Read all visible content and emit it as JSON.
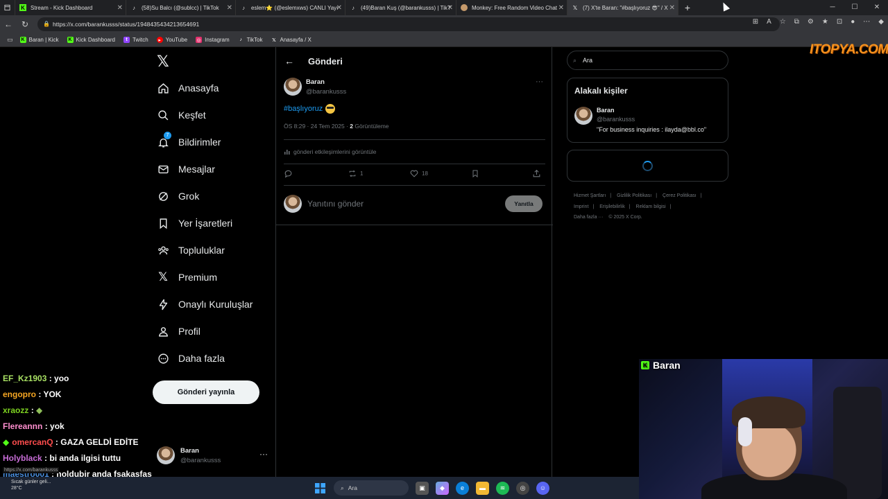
{
  "tabs": [
    {
      "label": "Stream - Kick Dashboard",
      "icon": "kick-icon",
      "active": false
    },
    {
      "label": "(58)Su Balcı (@sublcc) | TikTok",
      "icon": "tiktok-icon",
      "active": false
    },
    {
      "label": "eslem⭐ (@eslemxws) CANLI Yayı",
      "icon": "tiktok-icon",
      "active": false
    },
    {
      "label": "(49)Baran Kuş (@barankusss) | TikT",
      "icon": "tiktok-icon",
      "active": false
    },
    {
      "label": "Monkey: Free Random Video Chat",
      "icon": "monkey-icon",
      "active": false
    },
    {
      "label": "(7) X'te Baran: \"#başlıyoruz 😎\" / X",
      "icon": "x-icon",
      "active": true
    }
  ],
  "browser": {
    "url": "https://x.com/barankusss/status/1948435434213654691",
    "new_tab": "+",
    "status_url": "https://x.com/barankusss"
  },
  "bookmarks": [
    {
      "label": "Baran | Kick",
      "icon": "kick-icon",
      "color": "#53fc18"
    },
    {
      "label": "Kick Dashboard",
      "icon": "kick-icon",
      "color": "#53fc18"
    },
    {
      "label": "Twitch",
      "icon": "twitch-icon",
      "color": "#9146ff"
    },
    {
      "label": "YouTube",
      "icon": "youtube-icon",
      "color": "#ff0000"
    },
    {
      "label": "Instagram",
      "icon": "instagram-icon",
      "color": "#e1306c"
    },
    {
      "label": "TikTok",
      "icon": "tiktok-icon",
      "color": "#000000"
    },
    {
      "label": "Anasayfa / X",
      "icon": "x-icon",
      "color": "#000000"
    }
  ],
  "sidebar": {
    "items": [
      {
        "label": "Anasayfa",
        "icon": "home-icon"
      },
      {
        "label": "Keşfet",
        "icon": "search-icon"
      },
      {
        "label": "Bildirimler",
        "icon": "bell-icon",
        "badge": "7"
      },
      {
        "label": "Mesajlar",
        "icon": "mail-icon"
      },
      {
        "label": "Grok",
        "icon": "grok-icon"
      },
      {
        "label": "Yer İşaretleri",
        "icon": "bookmark-icon"
      },
      {
        "label": "Topluluklar",
        "icon": "communities-icon"
      },
      {
        "label": "Premium",
        "icon": "x-icon"
      },
      {
        "label": "Onaylı Kuruluşlar",
        "icon": "lightning-icon"
      },
      {
        "label": "Profil",
        "icon": "person-icon"
      },
      {
        "label": "Daha fazla",
        "icon": "more-circle-icon"
      }
    ],
    "post_button": "Gönderi yayınla",
    "account": {
      "name": "Baran",
      "handle": "@barankusss",
      "more": "···"
    }
  },
  "post": {
    "header_title": "Gönderi",
    "author_name": "Baran",
    "author_handle": "@barankusss",
    "text": "#başlıyoruz",
    "time": "ÖS 8:29 · 24 Tem 2025 · ",
    "views_count": "2",
    "views_label": " Görüntüleme",
    "analytics_label": "gönderi etkileşimlerini görüntüle",
    "reply_count": "",
    "repost_count": "1",
    "like_count": "18",
    "reply_placeholder": "Yanıtını gönder",
    "reply_button": "Yanıtla",
    "more": "···"
  },
  "right": {
    "search_placeholder": "Ara",
    "related_title": "Alakalı kişiler",
    "related_name": "Baran",
    "related_handle": "@barankusss",
    "related_bio": "\"For business inquiries : ilayda@bbl.co\"",
    "footer": [
      "Hizmet Şartları",
      "|",
      "Gizlilik Politikası",
      "|",
      "Çerez Politikası",
      "|",
      "Imprint",
      "|",
      "Erişilebilirlik",
      "|",
      "Reklam bilgisi",
      "|",
      "Daha fazla ···",
      "© 2025 X Corp."
    ]
  },
  "watermark": "ITOPYA.COM",
  "chat": [
    {
      "user": "EF_Kz1903",
      "text": " : yoo",
      "color": "#a8e063"
    },
    {
      "user": "engopro",
      "text": " : YOK",
      "color": "#f5a623"
    },
    {
      "user": "xraozz",
      "text": " : ",
      "color": "#7ed321"
    },
    {
      "user": "Flereannn",
      "text": " : yok",
      "color": "#ff8fcf"
    },
    {
      "user": "omercanQ",
      "text": " : GAZA GELDİ EDİTE",
      "color": "#ff4d4d"
    },
    {
      "user": "Holyblack",
      "text": " : bi anda ilgisi tuttu",
      "color": "#c86dd7"
    },
    {
      "user": "maestro001",
      "text": " : noldubir anda fsakasfas",
      "color": "#4a90e2"
    }
  ],
  "stream": {
    "streamer_name": "Baran"
  },
  "taskbar": {
    "weather_text": "Sıcak günler geli...",
    "temperature": "28°C",
    "search_label": "Ara"
  },
  "colors": {
    "accent": "#1d9bf0",
    "kick": "#53fc18",
    "bg": "#000000",
    "muted": "#71767b"
  }
}
